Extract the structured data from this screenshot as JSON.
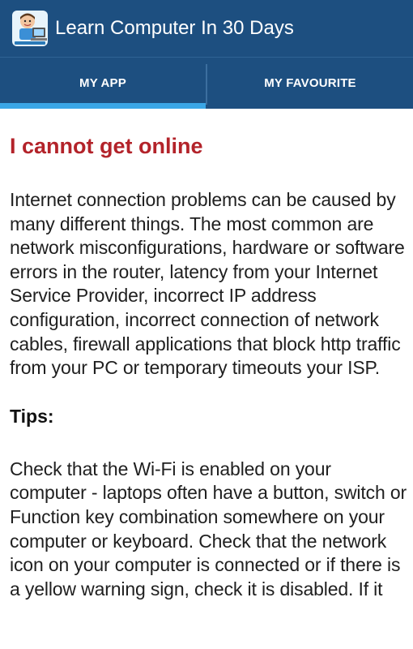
{
  "app_bar": {
    "title": "Learn Computer In 30 Days",
    "logo_icon": "boy-with-computer-logo-icon"
  },
  "tabs": [
    {
      "label": "MY APP",
      "selected": true
    },
    {
      "label": "MY FAVOURITE",
      "selected": false
    }
  ],
  "article": {
    "heading": "I cannot get online",
    "paragraph_1": "Internet connection problems can be caused by many different things. The most common are network misconfigurations, hardware or software errors in the router, latency from your Internet Service Provider, incorrect IP address configuration, incorrect connection of network cables, firewall applications that block http traffic from your PC or temporary timeouts your ISP.",
    "tips_label": "Tips:",
    "paragraph_2": "Check that the Wi-Fi is enabled on your computer - laptops often have a button, switch or Function key combination somewhere on your computer or keyboard. Check that the network icon on your computer is connected or if there is a yellow warning sign, check it is disabled. If it"
  },
  "colors": {
    "app_bar": "#1d4f80",
    "tab_indicator": "#3aa6e6",
    "heading": "#b3232a",
    "body_text": "#1f1f1f"
  }
}
